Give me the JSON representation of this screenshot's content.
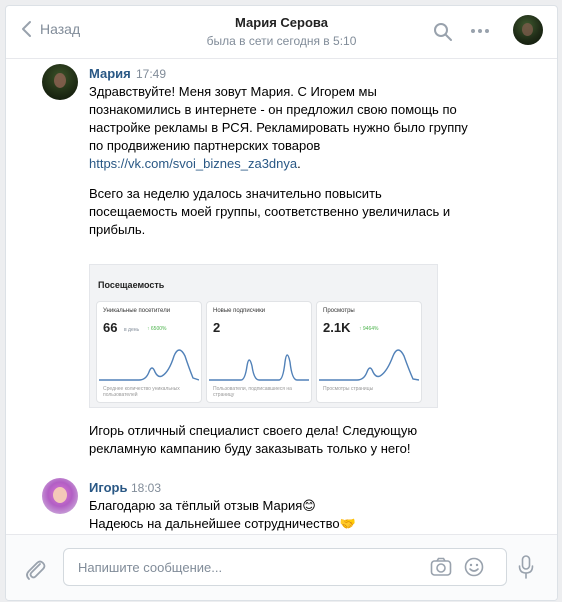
{
  "header": {
    "back_label": "Назад",
    "chat_title": "Мария Серова",
    "status": "была в сети сегодня в 5:10"
  },
  "messages": [
    {
      "author": "Мария",
      "time": "17:49",
      "paragraph1": "Здравствуйте! Меня зовут Мария. С Игорем мы познакомились в интернете - он предложил свою помощь по настройке рекламы в РСЯ. Рекламировать нужно было группу по продвижению партнерских товаров ",
      "link": "https://vk.com/svoi_biznes_za3dnya",
      "link_suffix": ".",
      "paragraph2": "Всего за неделю удалось значительно повысить посещаемость моей группы, соответственно увеличилась и прибыль.",
      "paragraph3": "Игорь отличный специалист своего дела! Следующую рекламную кампанию буду заказывать только у него!"
    },
    {
      "author": "Игорь",
      "time": "18:03",
      "line1": "Благодарю за тёплый отзыв Мария😊",
      "line2": "Надеюсь на дальнейшее сотрудничество🤝"
    }
  ],
  "stats_image": {
    "title": "Посещаемость",
    "cards": [
      {
        "title": "Уникальные посетители",
        "value": "66",
        "unit": "в день",
        "delta": "↑ 6500%",
        "note": "Среднее количество уникальных пользователей"
      },
      {
        "title": "Новые подписчики",
        "value": "2",
        "unit": "",
        "delta": "",
        "note": "Пользователи, подписавшиеся на страницу"
      },
      {
        "title": "Просмотры",
        "value": "2.1K",
        "unit": "",
        "delta": "↑ 9464%",
        "note": "Просмотры страницы"
      }
    ]
  },
  "composer": {
    "placeholder": "Напишите сообщение..."
  },
  "colors": {
    "link": "#2a5885",
    "muted": "#818c99",
    "accent_chart": "#5181b8",
    "delta_green": "#4bb34b"
  },
  "icons": [
    "chevron-left-icon",
    "search-icon",
    "more-icon",
    "paperclip-icon",
    "camera-icon",
    "smile-icon",
    "microphone-icon"
  ]
}
